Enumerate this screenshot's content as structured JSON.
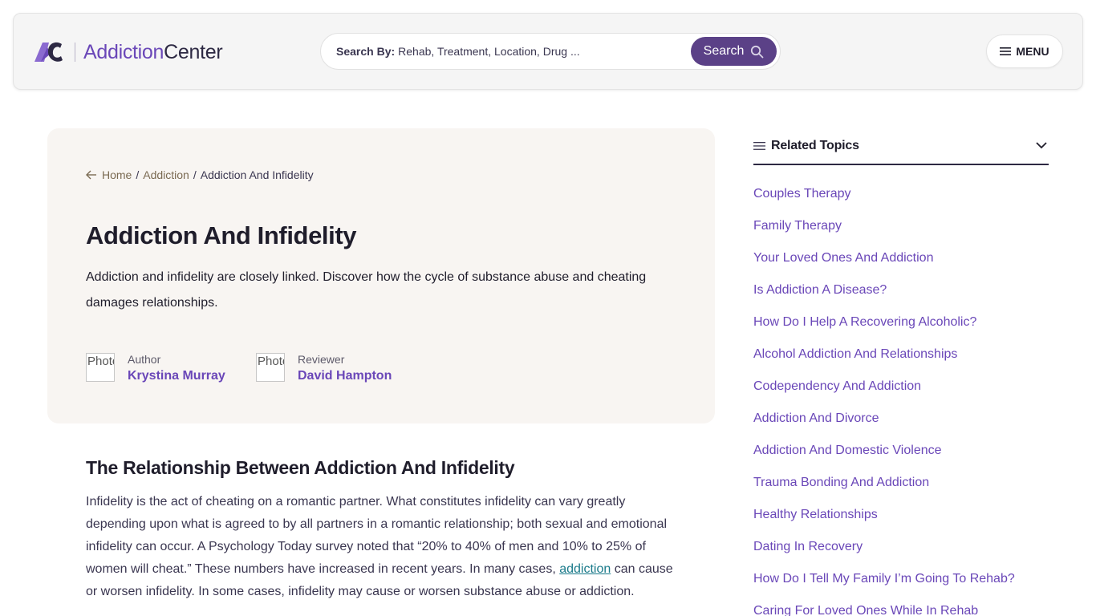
{
  "header": {
    "logo_part_a": "Addiction",
    "logo_part_b": "Center",
    "search_label": "Search By:",
    "search_placeholder": "Rehab, Treatment, Location, Drug ...",
    "search_button": "Search",
    "menu_label": "MENU"
  },
  "breadcrumb": {
    "items": [
      "Home",
      "Addiction"
    ],
    "current": "Addiction And Infidelity"
  },
  "hero": {
    "title": "Addiction And Infidelity",
    "description": "Addiction and infidelity are closely linked. Discover how the cycle of substance abuse and cheating damages relationships.",
    "author_role": "Author",
    "author_name": "Krystina Murray",
    "author_photo_alt": "Photo",
    "reviewer_role": "Reviewer",
    "reviewer_name": "David Hampton",
    "reviewer_photo_alt": "Photo"
  },
  "article": {
    "heading": "The Relationship Between Addiction And Infidelity",
    "p1_before": "Infidelity is the act of cheating on a romantic partner. What constitutes infidelity can vary greatly depending upon what is agreed to by all partners in a romantic relationship; both sexual and emotional infidelity can occur. A Psychology Today survey noted that “20% to 40% of men and 10% to 25% of women will cheat.” These numbers have increased in recent years. In many cases, ",
    "p1_link": "addiction",
    "p1_after": " can cause or worsen infidelity. In some cases, infidelity may cause or worsen substance abuse or addiction."
  },
  "sidebar": {
    "title": "Related Topics",
    "topics": [
      "Couples Therapy",
      "Family Therapy",
      "Your Loved Ones And Addiction",
      "Is Addiction A Disease?",
      "How Do I Help A Recovering Alcoholic?",
      "Alcohol Addiction And Relationships",
      "Codependency And Addiction",
      "Addiction And Divorce",
      "Addiction And Domestic Violence",
      "Trauma Bonding And Addiction",
      "Healthy Relationships",
      "Dating In Recovery",
      "How Do I Tell My Family I’m Going To Rehab?",
      "Caring For Loved Ones While In Rehab"
    ]
  },
  "colors": {
    "brand_purple": "#6a47b8",
    "search_button_bg": "#5b4187",
    "hero_bg": "#f8f5f2",
    "header_bg": "#f5f5f5",
    "link_teal": "#1a7a8a"
  }
}
